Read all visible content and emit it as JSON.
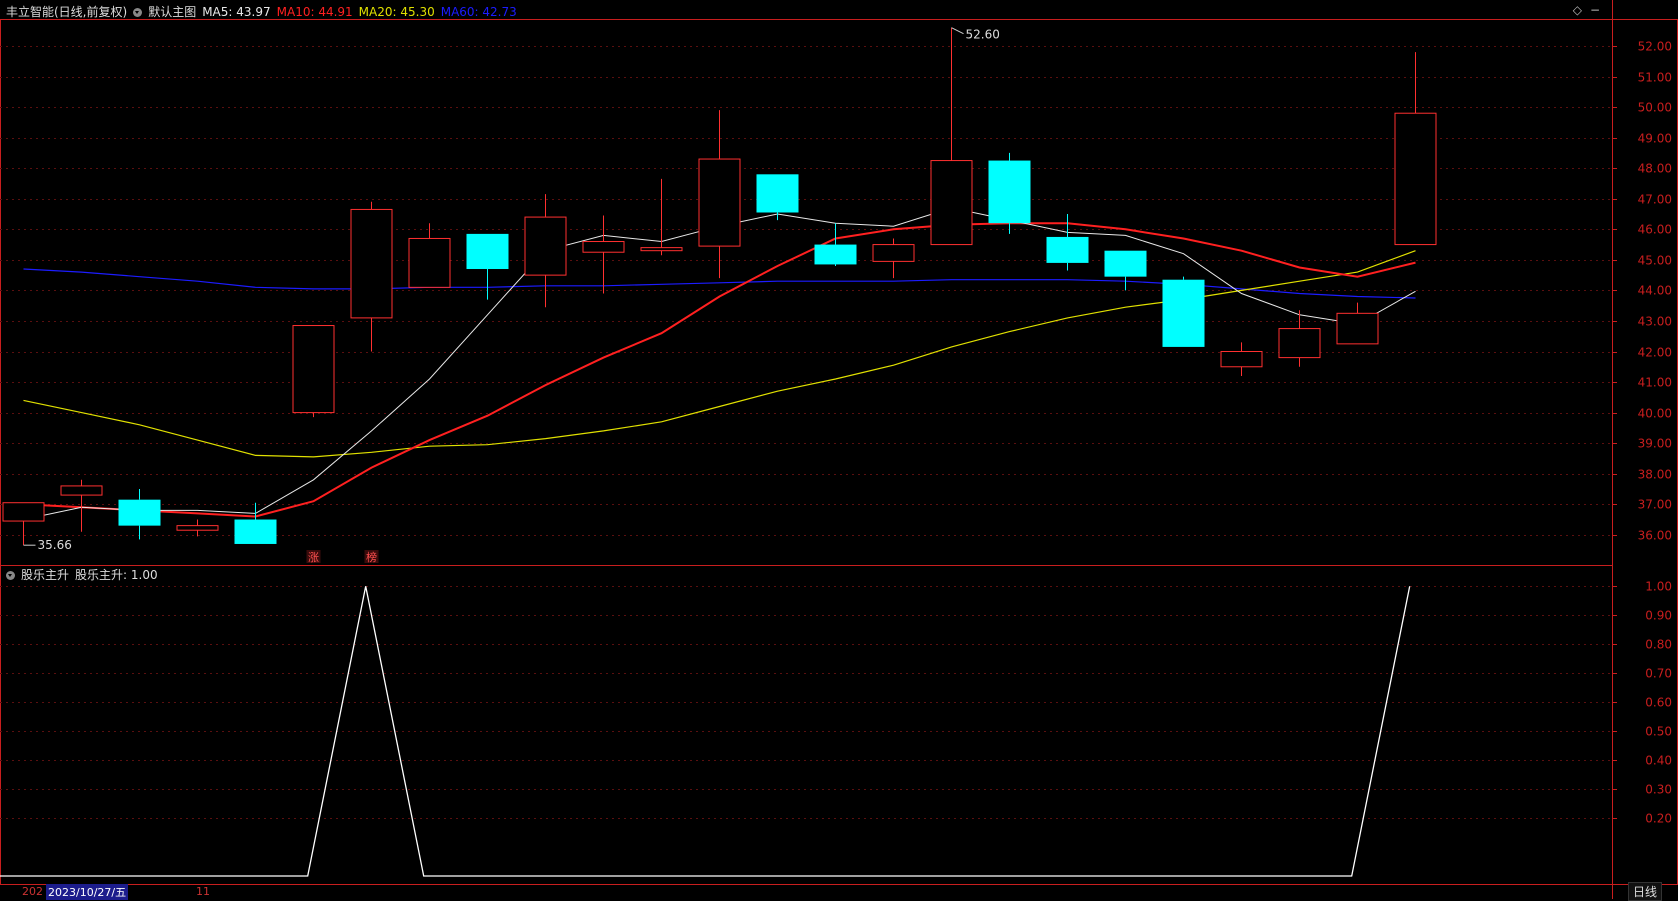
{
  "header": {
    "stock_name": "丰立智能(日线,前复权)",
    "template_name": "默认主图",
    "ma": [
      {
        "label": "MA5: 43.97",
        "color": "#e8e8e8"
      },
      {
        "label": "MA10: 44.91",
        "color": "#ff2020"
      },
      {
        "label": "MA20: 45.30",
        "color": "#e0e000"
      },
      {
        "label": "MA60: 42.73",
        "color": "#1c1cff"
      }
    ]
  },
  "sub_header": {
    "indicator_name": "股乐主升",
    "value_label": "股乐主升: 1.00"
  },
  "icons": [
    "diamond-icon",
    "minimize-icon"
  ],
  "date_bar": {
    "prefix": "202",
    "date_label": "2023/10/27/五",
    "month_label": "11"
  },
  "period_button": "日线",
  "colors": {
    "up": "#ff3030",
    "down": "#00ffff",
    "axis": "#c81e1e",
    "grid": "#5a0f0f",
    "ma5": "#e8e8e8",
    "ma10": "#ff2020",
    "ma20": "#e0e000",
    "ma60": "#1c1cff",
    "indicator_line": "#ffffff"
  },
  "chart_data": [
    {
      "type": "candlestick",
      "y_ticks": [
        "52.00",
        "51.00",
        "50.00",
        "49.00",
        "48.00",
        "47.00",
        "46.00",
        "45.00",
        "44.00",
        "43.00",
        "42.00",
        "41.00",
        "40.00",
        "39.00",
        "38.00",
        "37.00",
        "36.00"
      ],
      "ylim": [
        35.0,
        52.6
      ],
      "candles": [
        {
          "o": 36.45,
          "c": 37.05,
          "h": 37.05,
          "l": 35.66
        },
        {
          "o": 37.3,
          "c": 37.6,
          "h": 37.8,
          "l": 36.1
        },
        {
          "o": 37.15,
          "c": 36.3,
          "h": 37.5,
          "l": 35.85
        },
        {
          "o": 36.15,
          "c": 36.3,
          "h": 36.5,
          "l": 35.95
        },
        {
          "o": 36.5,
          "c": 35.7,
          "h": 37.05,
          "l": 35.7
        },
        {
          "o": 40.0,
          "c": 42.85,
          "h": 42.85,
          "l": 39.85
        },
        {
          "o": 43.1,
          "c": 46.65,
          "h": 46.9,
          "l": 42.0
        },
        {
          "o": 44.1,
          "c": 45.7,
          "h": 46.2,
          "l": 44.1
        },
        {
          "o": 45.85,
          "c": 44.7,
          "h": 45.85,
          "l": 43.7
        },
        {
          "o": 44.5,
          "c": 46.4,
          "h": 47.15,
          "l": 43.45
        },
        {
          "o": 45.25,
          "c": 45.6,
          "h": 46.45,
          "l": 43.9
        },
        {
          "o": 45.3,
          "c": 45.4,
          "h": 47.65,
          "l": 45.15
        },
        {
          "o": 45.45,
          "c": 48.3,
          "h": 49.9,
          "l": 44.4
        },
        {
          "o": 47.8,
          "c": 46.55,
          "h": 47.8,
          "l": 46.3
        },
        {
          "o": 45.5,
          "c": 44.85,
          "h": 46.2,
          "l": 44.8
        },
        {
          "o": 44.95,
          "c": 45.5,
          "h": 45.7,
          "l": 44.4
        },
        {
          "o": 45.5,
          "c": 48.25,
          "h": 52.6,
          "l": 45.5
        },
        {
          "o": 48.25,
          "c": 46.2,
          "h": 48.5,
          "l": 45.85
        },
        {
          "o": 45.75,
          "c": 44.9,
          "h": 46.5,
          "l": 44.65
        },
        {
          "o": 45.3,
          "c": 44.45,
          "h": 45.3,
          "l": 44.0
        },
        {
          "o": 44.35,
          "c": 42.15,
          "h": 44.45,
          "l": 42.15
        },
        {
          "o": 41.5,
          "c": 42.0,
          "h": 42.3,
          "l": 41.2
        },
        {
          "o": 41.8,
          "c": 42.75,
          "h": 43.35,
          "l": 41.5
        },
        {
          "o": 42.25,
          "c": 43.25,
          "h": 43.6,
          "l": 42.25
        },
        {
          "o": 45.5,
          "c": 49.8,
          "h": 51.8,
          "l": 45.5
        }
      ],
      "series": [
        {
          "name": "MA5",
          "values": [
            36.5,
            36.9,
            36.8,
            36.8,
            36.7,
            37.8,
            39.4,
            41.1,
            43.2,
            45.3,
            45.8,
            45.6,
            46.1,
            46.5,
            46.2,
            46.1,
            46.7,
            46.3,
            45.9,
            45.8,
            45.2,
            43.9,
            43.2,
            42.9,
            43.97
          ]
        },
        {
          "name": "MA10",
          "values": [
            37.0,
            36.9,
            36.8,
            36.7,
            36.6,
            37.1,
            38.2,
            39.1,
            39.9,
            40.9,
            41.8,
            42.6,
            43.8,
            44.8,
            45.7,
            46.0,
            46.15,
            46.2,
            46.2,
            46.0,
            45.7,
            45.3,
            44.75,
            44.45,
            44.91
          ]
        },
        {
          "name": "MA20",
          "values": [
            40.4,
            40.0,
            39.6,
            39.1,
            38.6,
            38.55,
            38.7,
            38.9,
            38.95,
            39.15,
            39.4,
            39.7,
            40.2,
            40.7,
            41.1,
            41.55,
            42.15,
            42.65,
            43.1,
            43.45,
            43.7,
            44.0,
            44.3,
            44.6,
            45.3
          ]
        },
        {
          "name": "MA60",
          "values": [
            44.7,
            44.6,
            44.45,
            44.3,
            44.1,
            44.05,
            44.05,
            44.1,
            44.1,
            44.15,
            44.15,
            44.2,
            44.25,
            44.3,
            44.3,
            44.3,
            44.35,
            44.35,
            44.35,
            44.3,
            44.2,
            44.05,
            43.9,
            43.8,
            43.75
          ]
        }
      ],
      "annotations": [
        {
          "label": "52.60",
          "candle_index": 16,
          "side": "right"
        },
        {
          "label": "35.66",
          "candle_index": 0,
          "side": "right"
        }
      ],
      "markers": [
        {
          "label": "涨",
          "candle_index": 5
        },
        {
          "label": "榜",
          "candle_index": 6
        }
      ]
    },
    {
      "type": "line",
      "name": "股乐主升",
      "y_ticks": [
        "1.00",
        "0.90",
        "0.80",
        "0.70",
        "0.60",
        "0.50",
        "0.40",
        "0.30",
        "0.20"
      ],
      "ylim": [
        0,
        1
      ],
      "points": [
        [
          -0.5,
          0
        ],
        [
          4.9,
          0
        ],
        [
          5.9,
          1
        ],
        [
          6.9,
          0
        ],
        [
          22.9,
          0
        ],
        [
          23.9,
          1
        ]
      ]
    }
  ]
}
